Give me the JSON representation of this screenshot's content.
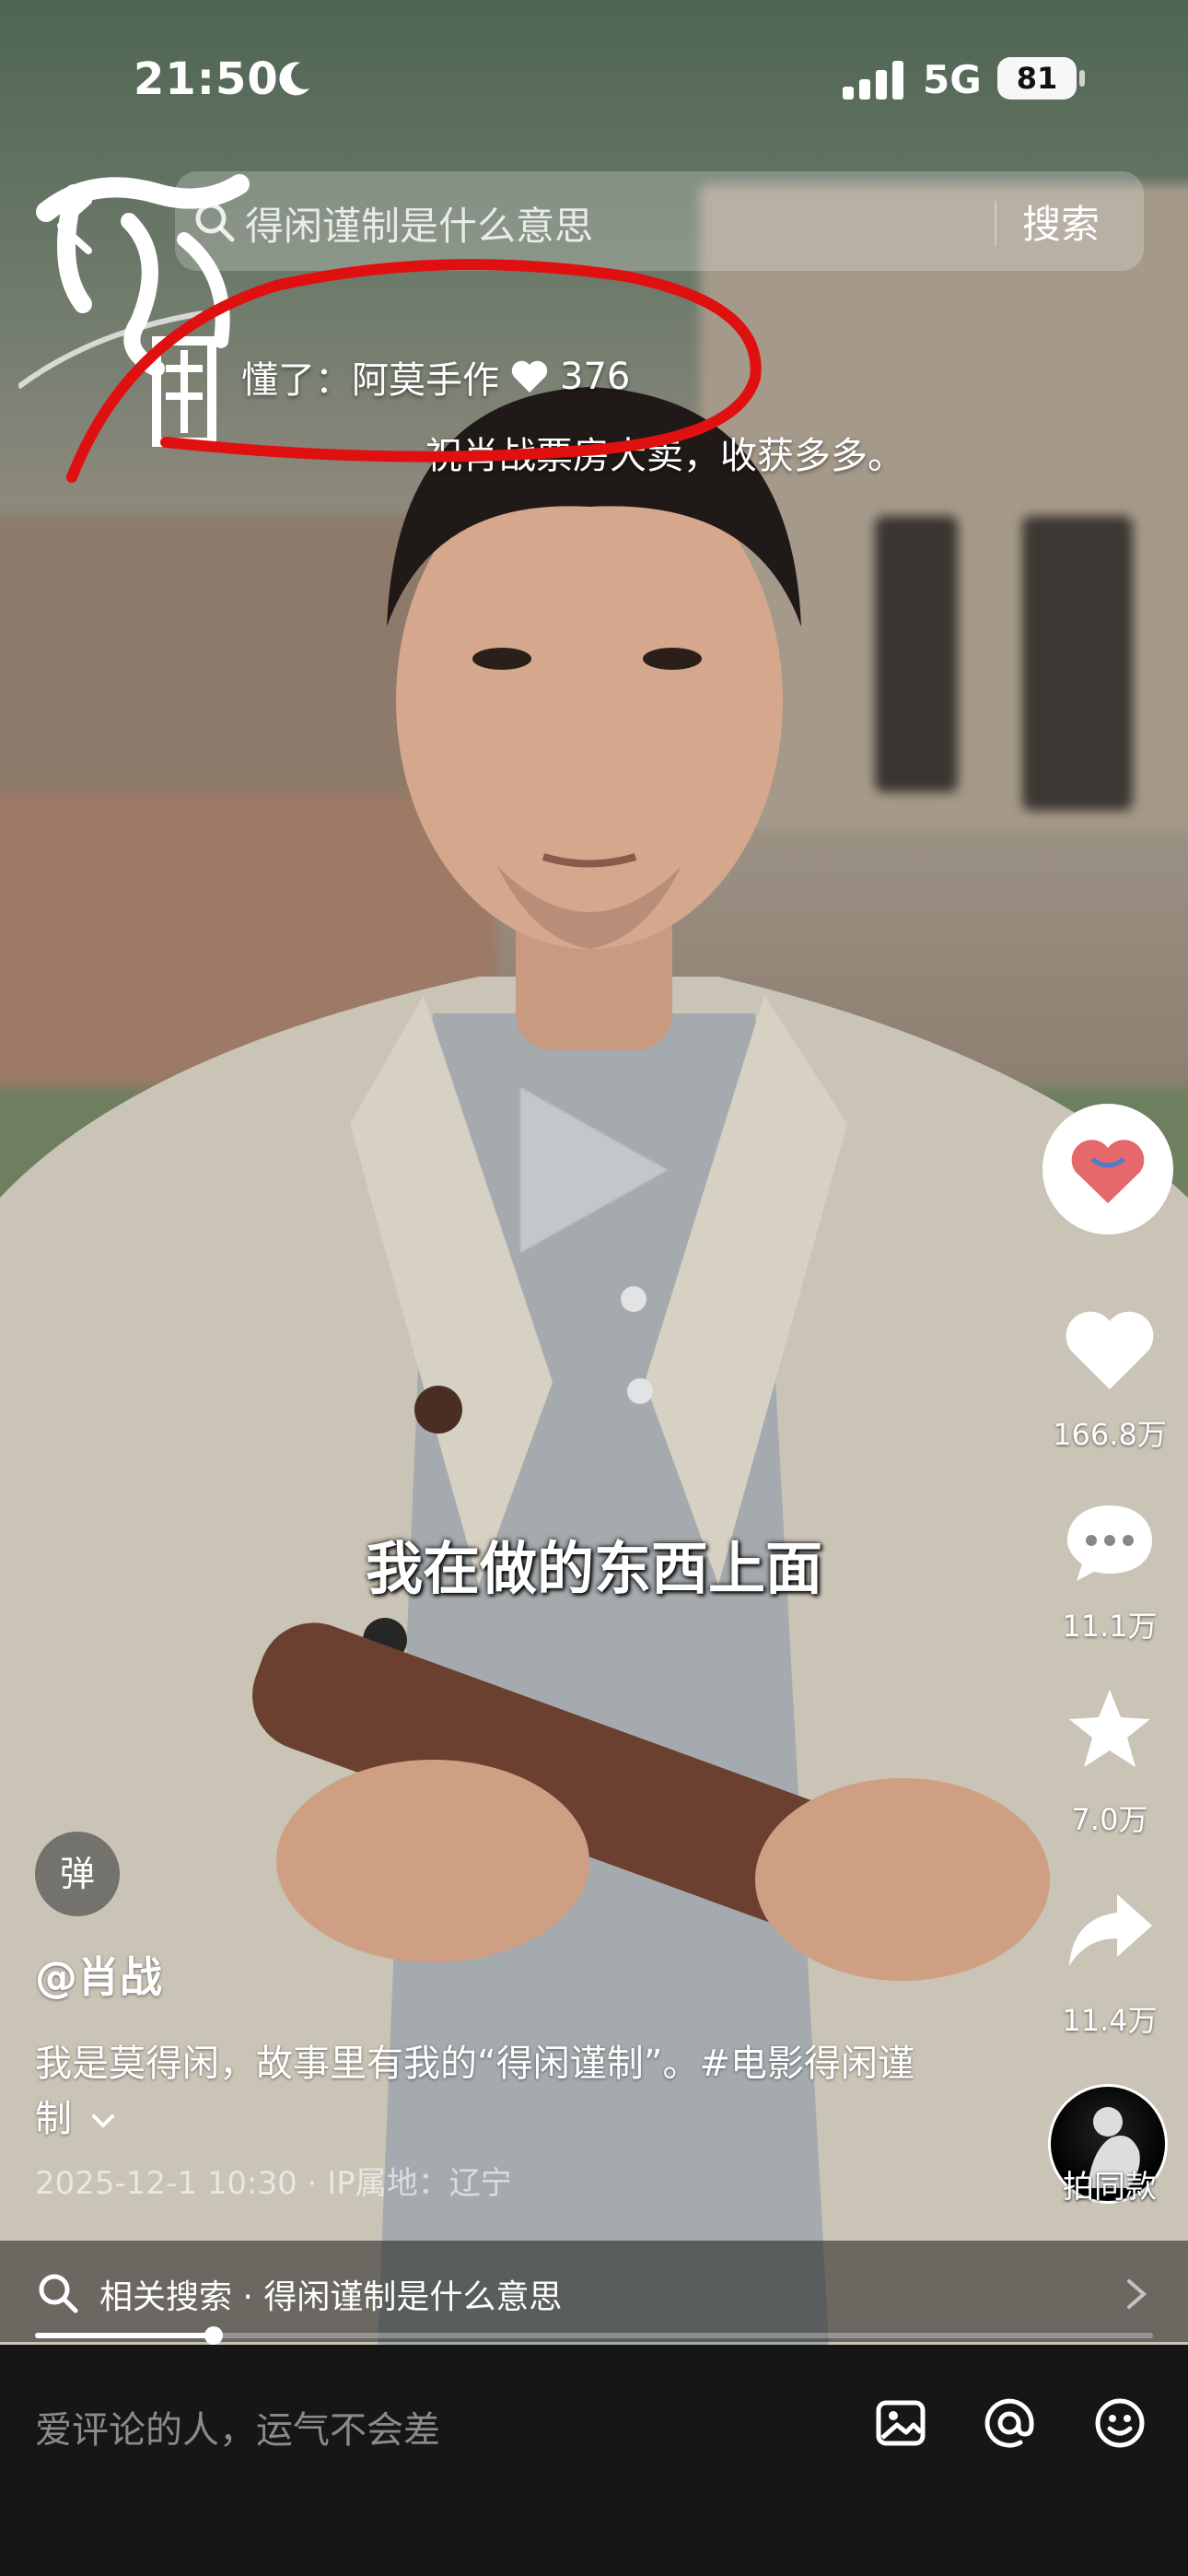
{
  "status_bar": {
    "time": "21:50",
    "network": "5G",
    "battery": "81"
  },
  "search": {
    "query": "得闲谨制是什么意思",
    "button_label": "搜索"
  },
  "danmaku": {
    "first": {
      "user": "懂了：阿莫手作",
      "likes": "376"
    },
    "second": "祝肖战票房大卖，收获多多。"
  },
  "subtitle": "我在做的东西上面",
  "actions": {
    "likes": "166.8万",
    "comments": "11.1万",
    "favorites": "7.0万",
    "shares": "11.4万",
    "remix_label": "拍同款"
  },
  "post": {
    "danmu_button": "弹",
    "author": "@肖战",
    "description": "我是莫得闲，故事里有我的“得闲谨制”。#电影得闲谨制",
    "meta": "2025-12-1 10:30 · IP属地：辽宁"
  },
  "related_search": {
    "text": "相关搜索 · 得闲谨制是什么意思"
  },
  "progress": {
    "fraction": 0.16
  },
  "comment_bar": {
    "placeholder": "爱评论的人，运气不会差"
  },
  "colors": {
    "annotation_red": "#e01010",
    "comment_bar_bg": "#161616"
  },
  "icons": [
    "moon-icon",
    "signal-icon",
    "back-icon",
    "search-icon",
    "heart-icon",
    "comment-icon",
    "star-icon",
    "share-icon",
    "image-icon",
    "at-icon",
    "emoji-icon"
  ]
}
